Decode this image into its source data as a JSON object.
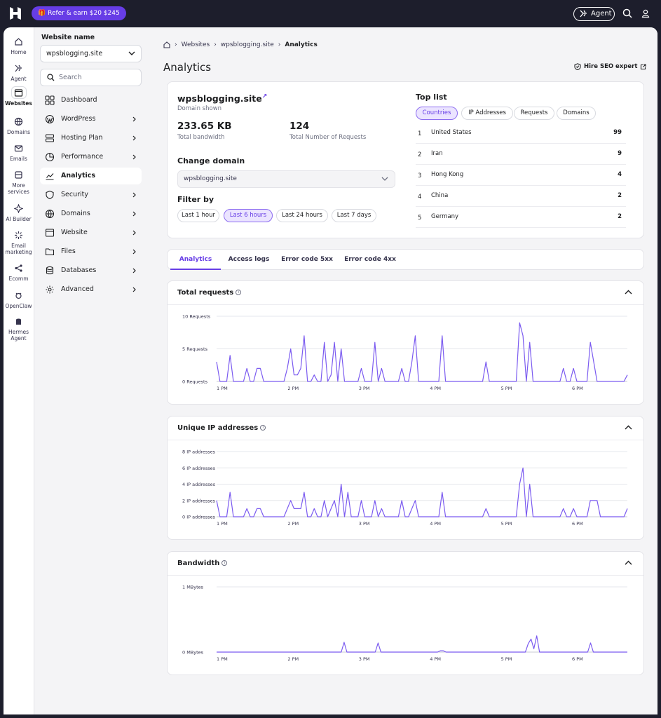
{
  "topbar": {
    "promo": "Refer & earn $20 $245",
    "agent": "Agent"
  },
  "rail": [
    "Home",
    "Agent",
    "Websites",
    "Domains",
    "Emails",
    "More services",
    "AI Builder",
    "Email marketing",
    "Ecomm",
    "OpenClaw",
    "Hermes Agent"
  ],
  "sidebar": {
    "title": "Website name",
    "site": "wpsblogging.site",
    "search_placeholder": "Search",
    "items": [
      {
        "label": "Dashboard",
        "icon": "dashboard-icon"
      },
      {
        "label": "WordPress",
        "icon": "wordpress-icon"
      },
      {
        "label": "Hosting Plan",
        "icon": "server-icon"
      },
      {
        "label": "Performance",
        "icon": "pie-icon"
      },
      {
        "label": "Analytics",
        "icon": "chart-icon"
      },
      {
        "label": "Security",
        "icon": "shield-icon"
      },
      {
        "label": "Domains",
        "icon": "globe-icon"
      },
      {
        "label": "Website",
        "icon": "window-icon"
      },
      {
        "label": "Files",
        "icon": "folder-icon"
      },
      {
        "label": "Databases",
        "icon": "database-icon"
      },
      {
        "label": "Advanced",
        "icon": "gear-icon"
      }
    ]
  },
  "breadcrumb": [
    "Websites",
    "wpsblogging.site",
    "Analytics"
  ],
  "page": {
    "title": "Analytics",
    "hire": "Hire SEO expert"
  },
  "summary": {
    "domain": "wpsblogging.site",
    "domain_caption": "Domain shown",
    "bandwidth": "233.65 KB",
    "bandwidth_label": "Total bandwidth",
    "requests": "124",
    "requests_label": "Total Number of Requests",
    "change_domain": "Change domain",
    "selected_domain": "wpsblogging.site",
    "filter_by": "Filter by",
    "filters": [
      "Last 1 hour",
      "Last 6 hours",
      "Last 24 hours",
      "Last 7 days"
    ]
  },
  "toplist": {
    "title": "Top list",
    "tabs": [
      "Countries",
      "IP Addresses",
      "Requests",
      "Domains"
    ],
    "rows": [
      {
        "rank": "1",
        "name": "United States",
        "value": "99"
      },
      {
        "rank": "2",
        "name": "Iran",
        "value": "9"
      },
      {
        "rank": "3",
        "name": "Hong Kong",
        "value": "4"
      },
      {
        "rank": "4",
        "name": "China",
        "value": "2"
      },
      {
        "rank": "5",
        "name": "Germany",
        "value": "2"
      }
    ]
  },
  "tabs": [
    "Analytics",
    "Access logs",
    "Error code 5xx",
    "Error code 4xx"
  ],
  "colors": {
    "accent": "#673de6",
    "line": "#7b5bf0"
  },
  "chart_data": [
    {
      "type": "line",
      "title": "Total requests",
      "x_ticks": [
        "1 PM",
        "2 PM",
        "3 PM",
        "4 PM",
        "5 PM",
        "6 PM"
      ],
      "y_ticks": [
        "0 Requests",
        "5 Requests",
        "10 Requests"
      ],
      "ylim": [
        0,
        10
      ],
      "values": [
        3,
        0,
        0,
        0,
        4,
        0,
        0,
        0,
        0,
        2,
        0,
        0,
        2,
        2,
        0,
        0,
        0,
        0,
        0,
        0,
        0,
        2,
        5,
        1,
        1,
        2,
        7,
        0,
        0,
        1,
        0,
        0,
        6,
        0,
        1,
        6,
        0,
        5,
        0,
        0,
        0,
        0,
        0,
        2,
        0,
        0,
        0,
        6,
        0,
        2,
        0,
        0,
        0,
        0,
        0,
        2,
        0,
        0,
        3,
        7,
        0,
        0,
        0,
        0,
        0,
        0,
        0,
        7,
        0,
        0,
        0,
        0,
        0,
        0,
        0,
        0,
        0,
        0,
        0,
        0,
        3,
        0,
        0,
        0,
        0,
        0,
        0,
        0,
        0,
        0,
        9,
        7,
        0,
        6,
        0,
        0,
        0,
        0,
        0,
        0,
        0,
        0,
        0,
        2,
        0,
        0,
        2,
        0,
        0,
        0,
        0,
        6,
        3,
        0,
        0,
        0,
        0,
        0,
        0,
        0,
        0,
        0,
        1
      ]
    },
    {
      "type": "line",
      "title": "Unique IP addresses",
      "x_ticks": [
        "1 PM",
        "2 PM",
        "3 PM",
        "4 PM",
        "5 PM",
        "6 PM"
      ],
      "y_ticks": [
        "0 IP addresses",
        "2 IP addresses",
        "4 IP addresses",
        "6 IP addresses",
        "8 IP addresses"
      ],
      "ylim": [
        0,
        8
      ],
      "values": [
        2,
        0,
        0,
        0,
        3,
        0,
        0,
        0,
        0,
        1,
        0,
        0,
        1,
        1,
        0,
        0,
        0,
        0,
        0,
        0,
        0,
        1,
        2,
        1,
        1,
        1,
        3,
        0,
        0,
        1,
        0,
        0,
        2,
        0,
        1,
        2,
        0,
        4,
        0,
        3,
        0,
        0,
        0,
        2,
        0,
        0,
        0,
        2,
        0,
        1,
        0,
        0,
        0,
        0,
        0,
        2,
        0,
        0,
        1,
        2,
        0,
        0,
        0,
        0,
        0,
        0,
        0,
        3,
        0,
        0,
        0,
        0,
        0,
        0,
        0,
        0,
        0,
        0,
        0,
        0,
        1,
        0,
        0,
        0,
        0,
        0,
        0,
        0,
        0,
        0,
        4,
        6,
        0,
        4,
        0,
        0,
        0,
        0,
        0,
        0,
        0,
        0,
        0,
        1,
        0,
        0,
        1,
        0,
        0,
        0,
        0,
        2,
        2,
        2,
        0,
        0,
        0,
        0,
        0,
        0,
        0,
        0,
        1
      ]
    },
    {
      "type": "line",
      "title": "Bandwidth",
      "x_ticks": [
        "1 PM",
        "2 PM",
        "3 PM",
        "4 PM",
        "5 PM",
        "6 PM"
      ],
      "y_ticks": [
        "0 MBytes",
        "1 MBytes"
      ],
      "ylim": [
        0,
        1
      ],
      "values": [
        0,
        0,
        0,
        0,
        0,
        0,
        0,
        0,
        0,
        0,
        0,
        0,
        0,
        0,
        0,
        0,
        0,
        0,
        0,
        0,
        0,
        0,
        0,
        0,
        0,
        0,
        0,
        0,
        0,
        0,
        0,
        0,
        0,
        0,
        0,
        0,
        0,
        0,
        0,
        0,
        0,
        0,
        0,
        0,
        0,
        0.15,
        0,
        0,
        0,
        0,
        0,
        0,
        0,
        0,
        0,
        0,
        0,
        0.14,
        0,
        0,
        0,
        0,
        0,
        0,
        0,
        0,
        0,
        0,
        0,
        0,
        0,
        0,
        0,
        0,
        0,
        0,
        0,
        0,
        0,
        0.02,
        0.02,
        0,
        0,
        0,
        0,
        0,
        0,
        0,
        0,
        0,
        0,
        0,
        0,
        0,
        0,
        0,
        0,
        0,
        0,
        0,
        0,
        0,
        0,
        0,
        0,
        0,
        0,
        0,
        0,
        0,
        0.13,
        0.2,
        0.05,
        0.25,
        0,
        0,
        0,
        0,
        0,
        0,
        0,
        0,
        0,
        0,
        0,
        0,
        0,
        0,
        0,
        0,
        0,
        0,
        0.14,
        0,
        0,
        0,
        0,
        0,
        0,
        0,
        0,
        0,
        0,
        0,
        0,
        0
      ]
    }
  ]
}
